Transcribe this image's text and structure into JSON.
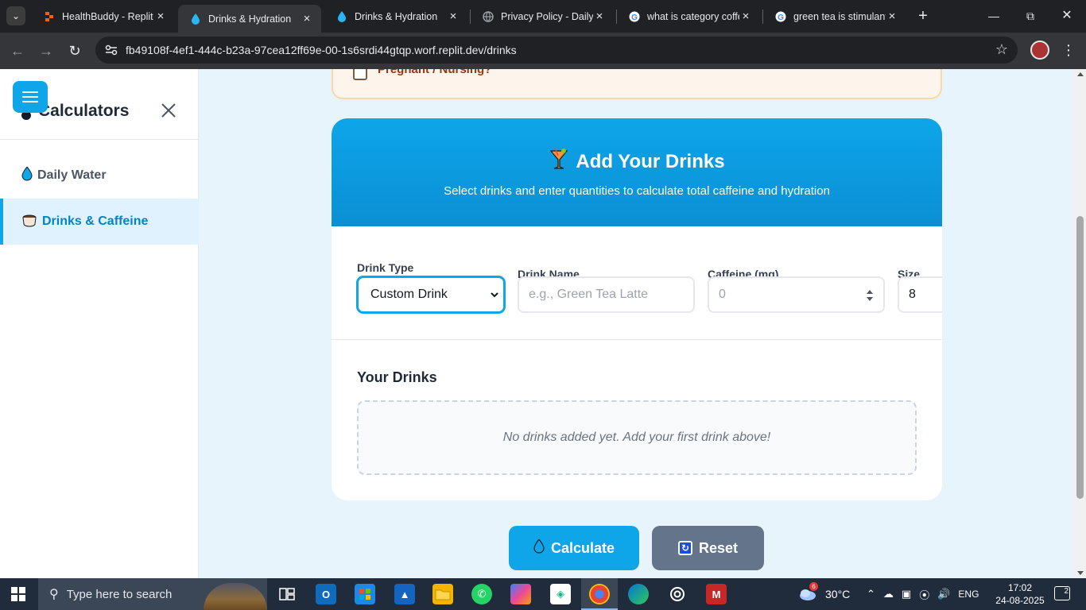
{
  "browser": {
    "tabs": [
      {
        "title": "HealthBuddy - Replit",
        "icon": "replit-icon",
        "active": false
      },
      {
        "title": "Drinks & Hydration",
        "icon": "water-drop-icon",
        "active": true
      },
      {
        "title": "Drinks & Hydration",
        "icon": "water-drop-icon",
        "active": false
      },
      {
        "title": "Privacy Policy - Daily",
        "icon": "globe-icon",
        "active": false
      },
      {
        "title": "what is category coffe",
        "icon": "google-icon",
        "active": false
      },
      {
        "title": "green tea is stimulant",
        "icon": "google-icon",
        "active": false
      }
    ],
    "url": "fb49108f-4ef1-444c-b23a-97cea12ff69e-00-1s6srdi44gtqp.worf.replit.dev/drinks"
  },
  "sidebar": {
    "title": "Calculators",
    "items": [
      {
        "label": "Daily Water",
        "icon": "water-drop-icon",
        "active": false
      },
      {
        "label": "Drinks & Caffeine",
        "icon": "coffee-cup-icon",
        "active": true
      }
    ]
  },
  "warning": {
    "checkbox_label": "Pregnant / Nursing?",
    "checked": false
  },
  "drinks_card": {
    "title": "Add Your Drinks",
    "subtitle": "Select drinks and enter quantities to calculate total caffeine and hydration",
    "fields": {
      "drink_type": {
        "label": "Drink Type",
        "value": "Custom Drink"
      },
      "drink_name": {
        "label": "Drink Name",
        "placeholder": "e.g., Green Tea Latte",
        "value": ""
      },
      "caffeine": {
        "label": "Caffeine (mg)",
        "placeholder": "0"
      },
      "size": {
        "label": "Size (oz)",
        "value": "8"
      }
    },
    "list_heading": "Your Drinks",
    "empty_message": "No drinks added yet. Add your first drink above!"
  },
  "actions": {
    "calculate": "Calculate",
    "reset": "Reset"
  },
  "taskbar": {
    "search_placeholder": "Type here to search",
    "weather": "30°C",
    "weather_badge": "6",
    "language": "ENG",
    "time": "17:02",
    "date": "24-08-2025",
    "notification_count": "2"
  },
  "colors": {
    "accent": "#0ea5e9",
    "reset_button": "#64748b",
    "page_bg": "#e8f4fc",
    "warning_text": "#9a3412"
  }
}
